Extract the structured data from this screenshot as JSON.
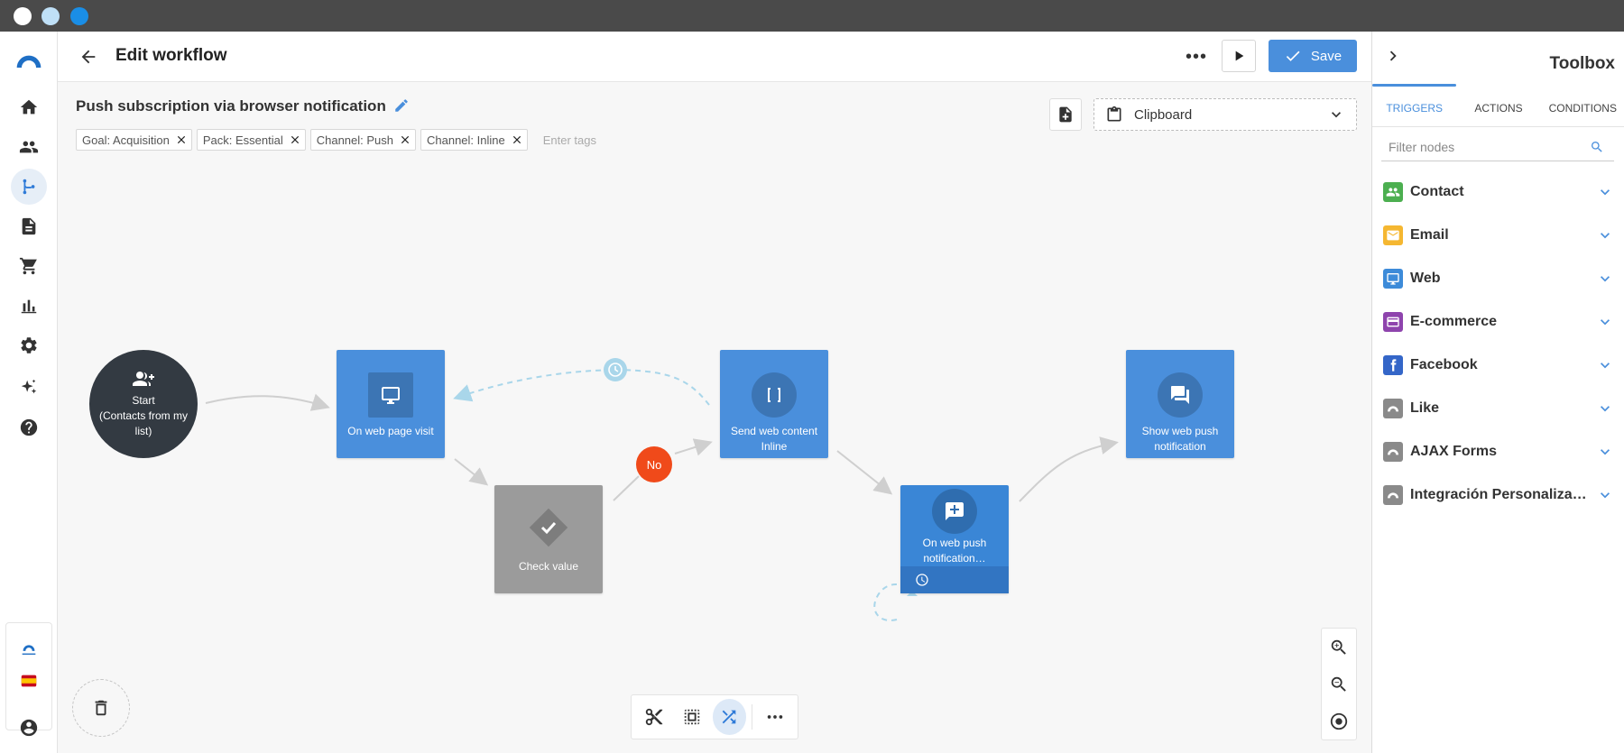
{
  "header": {
    "title": "Edit workflow",
    "more_label": "•••",
    "save_label": "Save"
  },
  "workflow": {
    "name": "Push subscription via browser notification",
    "tags": [
      "Goal: Acquisition",
      "Pack: Essential",
      "Channel: Push",
      "Channel: Inline"
    ],
    "tag_placeholder": "Enter tags",
    "clipboard_label": "Clipboard"
  },
  "nodes": {
    "start": [
      "Start",
      "(Contacts from my list)"
    ],
    "web_page_visit": "On web page visit",
    "check_value": "Check value",
    "send_web_content": [
      "Send web content",
      "Inline"
    ],
    "web_push_notification": [
      "On web push",
      "notification…"
    ],
    "show_web_push": [
      "Show web push",
      "notification"
    ],
    "no_label": "No"
  },
  "toolbox": {
    "title": "Toolbox",
    "tabs": [
      "TRIGGERS",
      "ACTIONS",
      "CONDITIONS"
    ],
    "active_tab": "TRIGGERS",
    "filter_placeholder": "Filter nodes",
    "items": [
      {
        "label": "Contact",
        "color": "#4caf50",
        "icon": "people-icon"
      },
      {
        "label": "Email",
        "color": "#f5b731",
        "icon": "mail-icon"
      },
      {
        "label": "Web",
        "color": "#3d8bd9",
        "icon": "monitor-icon"
      },
      {
        "label": "E-commerce",
        "color": "#8e44ad",
        "icon": "card-icon"
      },
      {
        "label": "Facebook",
        "color": "#3466c8",
        "icon": "facebook-icon"
      },
      {
        "label": "Like",
        "color": "#8a8a8a",
        "icon": "connectif-icon"
      },
      {
        "label": "AJAX Forms",
        "color": "#8a8a8a",
        "icon": "connectif-icon"
      },
      {
        "label": "Integración Personaliza…",
        "color": "#8a8a8a",
        "icon": "connectif-icon"
      }
    ]
  },
  "colors": {
    "accent": "#4a8fdc",
    "node_blue": "#4a8fdc",
    "node_gray": "#9b9b9b",
    "start_dark": "#333a42",
    "no_badge": "#f04a1a"
  }
}
